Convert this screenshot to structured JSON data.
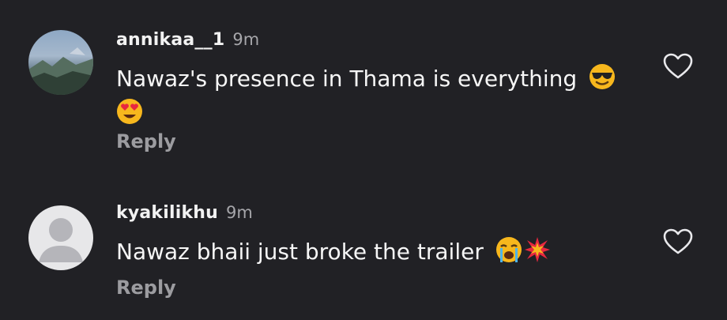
{
  "comments": [
    {
      "username": "annikaa__1",
      "time": "9m",
      "text": "Nawaz's presence in Thama is everything",
      "emojis": [
        "smiling-face-with-sunglasses-emoji",
        "smiling-face-with-heart-eyes-emoji"
      ],
      "reply_label": "Reply",
      "avatar": "landscape-photo-avatar"
    },
    {
      "username": "kyakilikhu",
      "time": "9m",
      "text": "Nawaz bhaii just broke the trailer",
      "emojis": [
        "loudly-crying-face-emoji",
        "collision-emoji"
      ],
      "reply_label": "Reply",
      "avatar": "default-user-avatar"
    }
  ],
  "colors": {
    "background": "#212125",
    "text": "#f6f6f6",
    "muted": "#9c9ca0"
  }
}
